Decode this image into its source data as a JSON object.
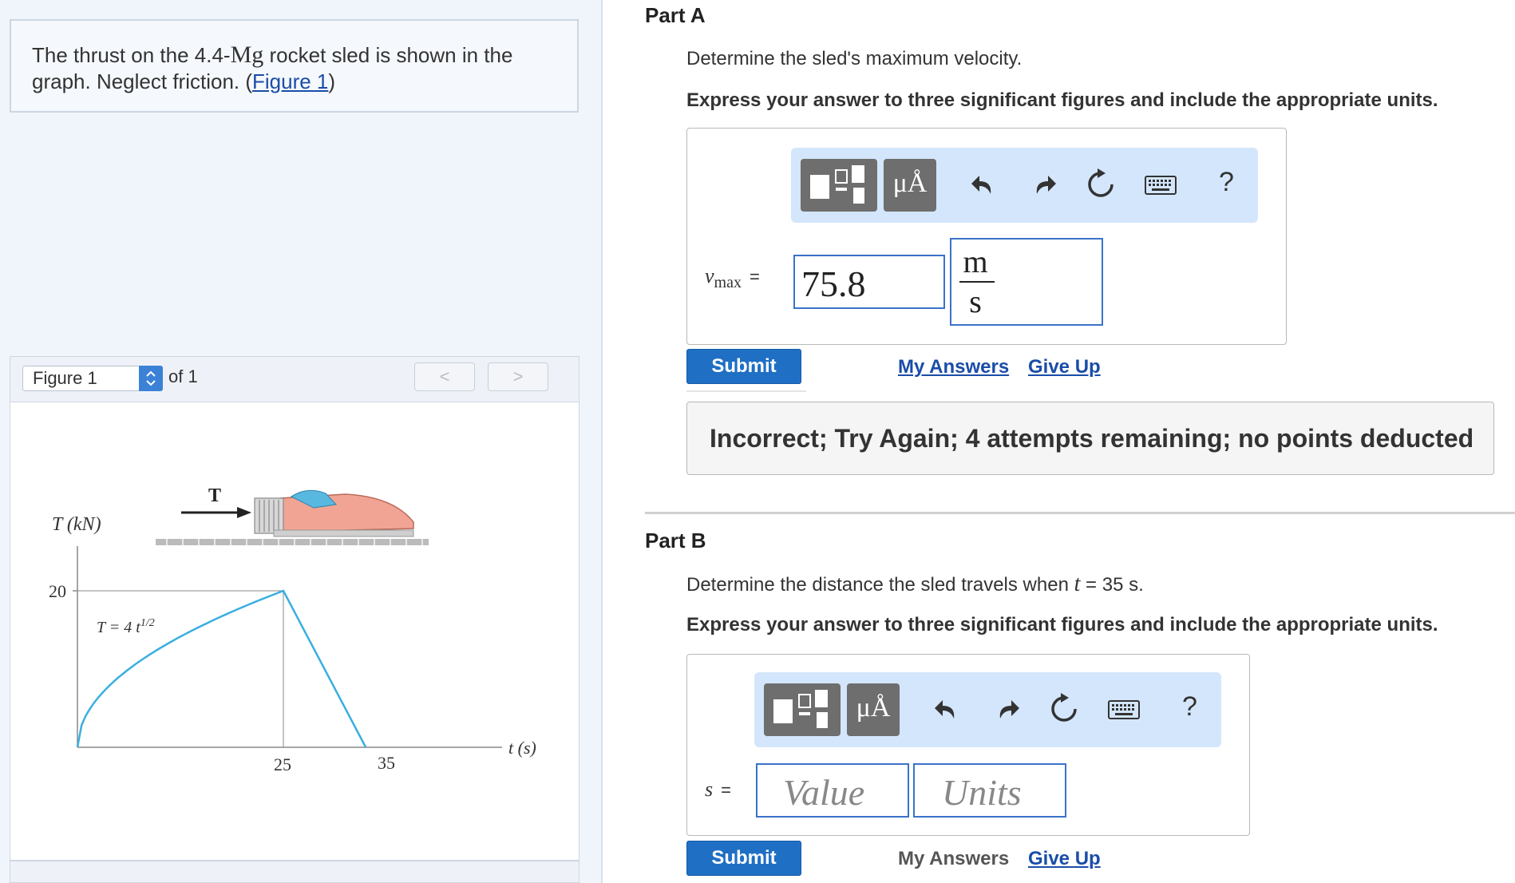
{
  "problem": {
    "text_before": "The thrust on the 4.4-",
    "unit": "Mg",
    "text_after": " rocket sled is shown in the graph. Neglect friction. (",
    "figure_link": "Figure 1",
    "close_paren": ")"
  },
  "figure_nav": {
    "selected": "Figure 1",
    "of_label": "of 1",
    "prev_glyph": "<",
    "next_glyph": ">"
  },
  "figure": {
    "y_axis_label": "T (kN)",
    "x_axis_label": "t (s)",
    "y_tick": "20",
    "x_ticks": [
      "25",
      "35"
    ],
    "curve_label": "T = 4 t",
    "curve_exponent": "1/2",
    "thrust_label": "T",
    "curve_color": "#3aaee0"
  },
  "part_a": {
    "title": "Part A",
    "question": "Determine the sled's maximum velocity.",
    "instruction": "Express your answer to three significant figures and include the appropriate units.",
    "var_main": "v",
    "var_sub": "max",
    "equals": "=",
    "value": "75.8",
    "unit_num": "m",
    "unit_den": "s",
    "submit": "Submit",
    "my_answers": "My Answers",
    "give_up": "Give Up",
    "feedback": "Incorrect; Try Again; 4 attempts remaining; no points deducted"
  },
  "part_b": {
    "title": "Part B",
    "question_before": "Determine the distance the sled travels when ",
    "question_var": "t",
    "question_after": " = 35 s.",
    "instruction": "Express your answer to three significant figures and include the appropriate units.",
    "var": "s",
    "equals": "=",
    "value_placeholder": "Value",
    "units_placeholder": "Units",
    "submit": "Submit",
    "my_answers": "My Answers",
    "give_up": "Give Up"
  },
  "toolbar": {
    "mu_label": "μÅ",
    "help": "?"
  },
  "colors": {
    "accent": "#1f6fc5",
    "toolbar_bg": "#d4e6fb",
    "link": "#1a4da8"
  }
}
